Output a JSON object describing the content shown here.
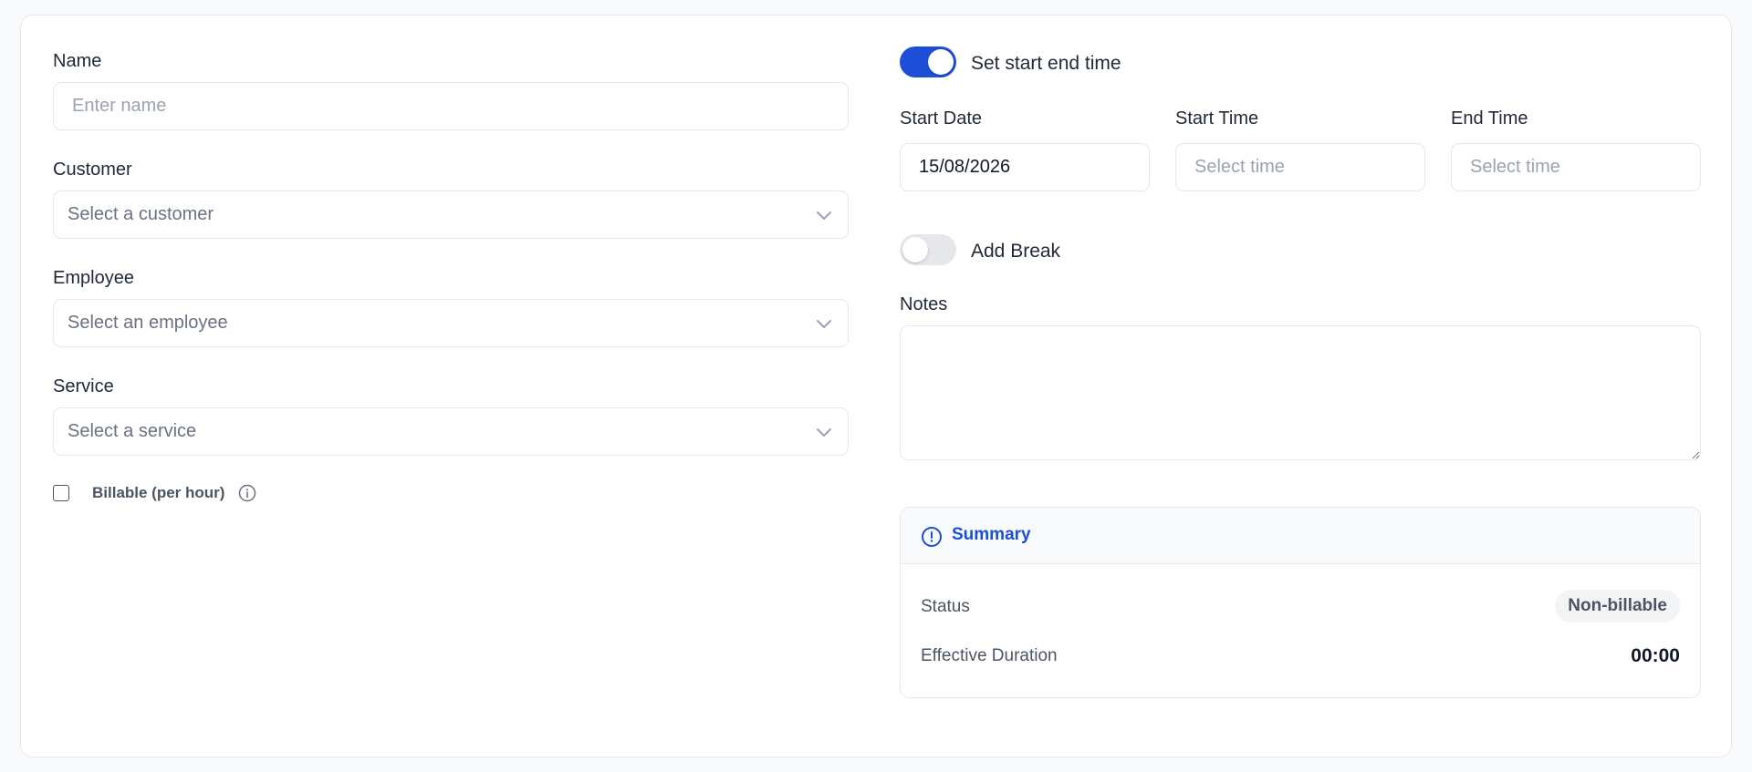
{
  "form": {
    "name": {
      "label": "Name",
      "placeholder": "Enter name"
    },
    "customer": {
      "label": "Customer",
      "placeholder": "Select a customer"
    },
    "employee": {
      "label": "Employee",
      "placeholder": "Select an employee"
    },
    "service": {
      "label": "Service",
      "placeholder": "Select a service"
    },
    "billable": {
      "label": "Billable (per hour)",
      "checked": false
    },
    "set_time_toggle": {
      "label": "Set start end time",
      "on": true
    },
    "start_date": {
      "label": "Start Date",
      "value": "15/08/2026"
    },
    "start_time": {
      "label": "Start Time",
      "placeholder": "Select time"
    },
    "end_time": {
      "label": "End Time",
      "placeholder": "Select time"
    },
    "add_break_toggle": {
      "label": "Add Break",
      "on": false
    },
    "notes": {
      "label": "Notes",
      "value": ""
    }
  },
  "summary": {
    "title": "Summary",
    "status_label": "Status",
    "status_value": "Non-billable",
    "duration_label": "Effective Duration",
    "duration_value": "00:00"
  },
  "colors": {
    "accent": "#1d4ed8",
    "toggle_on": "#1d4ed8",
    "toggle_off": "#e5e7eb"
  },
  "icons": {
    "select_chevron": "chevron-down-icon",
    "billable_info": "info-icon",
    "summary": "alert-circle-icon"
  }
}
